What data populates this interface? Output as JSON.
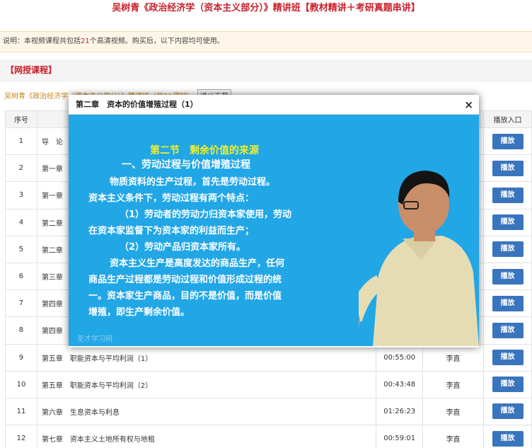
{
  "page": {
    "title": "吴树青《政治经济学（资本主义部分）》精讲班【教材精讲＋考研真题串讲】"
  },
  "notice": {
    "prefix": "说明：本视频课程共包括",
    "count": "21",
    "suffix": "个高清视频。购买后，以下内容均可使用。"
  },
  "section": {
    "heading": "【网授课程】"
  },
  "course": {
    "name": "吴树青《政治经济学（资本主义部分）》精讲班（共21课时）",
    "download_label": "讲义下载"
  },
  "table": {
    "headers": {
      "no": "序号",
      "title": "",
      "duration": "",
      "teacher": "",
      "play": "播放入口"
    },
    "play_label": "播放",
    "rows": [
      {
        "no": "1",
        "title": "导　论",
        "duration": "",
        "teacher": ""
      },
      {
        "no": "2",
        "title": "第一章",
        "duration": "",
        "teacher": ""
      },
      {
        "no": "3",
        "title": "第一章",
        "duration": "",
        "teacher": ""
      },
      {
        "no": "4",
        "title": "第二章",
        "duration": "",
        "teacher": ""
      },
      {
        "no": "5",
        "title": "第二章",
        "duration": "",
        "teacher": ""
      },
      {
        "no": "6",
        "title": "第三章",
        "duration": "",
        "teacher": ""
      },
      {
        "no": "7",
        "title": "第四章",
        "duration": "",
        "teacher": ""
      },
      {
        "no": "8",
        "title": "第四章",
        "duration": "",
        "teacher": ""
      },
      {
        "no": "9",
        "title": "第五章　职能资本与平均利润（1）",
        "duration": "00:55:00",
        "teacher": "李直"
      },
      {
        "no": "10",
        "title": "第五章　职能资本与平均利润（2）",
        "duration": "00:43:48",
        "teacher": "李直"
      },
      {
        "no": "11",
        "title": "第六章　生息资本与利息",
        "duration": "01:26:23",
        "teacher": "李直"
      },
      {
        "no": "12",
        "title": "第七章　资本主义土地所有权与地租",
        "duration": "00:59:01",
        "teacher": "李直"
      }
    ]
  },
  "modal": {
    "title": "第二章　资本的价值增殖过程（1）",
    "close_glyph": "×",
    "slide_lines": [
      "第二节　剩余价值的来源",
      "一、劳动过程与价值增殖过程",
      "物质资料的生产过程，首先是劳动过程。",
      "资本主义条件下，劳动过程有两个特点：",
      "（1）劳动者的劳动力归资本家使用，劳动",
      "在资本家监督下为资本家的利益而生产；",
      "（2）劳动产品归资本家所有。",
      "资本主义生产是高度发达的商品生产，任何",
      "商品生产过程都是劳动过程和价值形成过程的统",
      "一。资本家生产商品，目的不是价值，而是价值",
      "增殖，即生产剩余价值。"
    ],
    "watermark": "圣才学习网"
  },
  "colors": {
    "accent_red": "#c9202b",
    "play_button": "#3a74bd",
    "slide_background": "#21a6e6",
    "slide_heading": "#f2ef2a"
  }
}
